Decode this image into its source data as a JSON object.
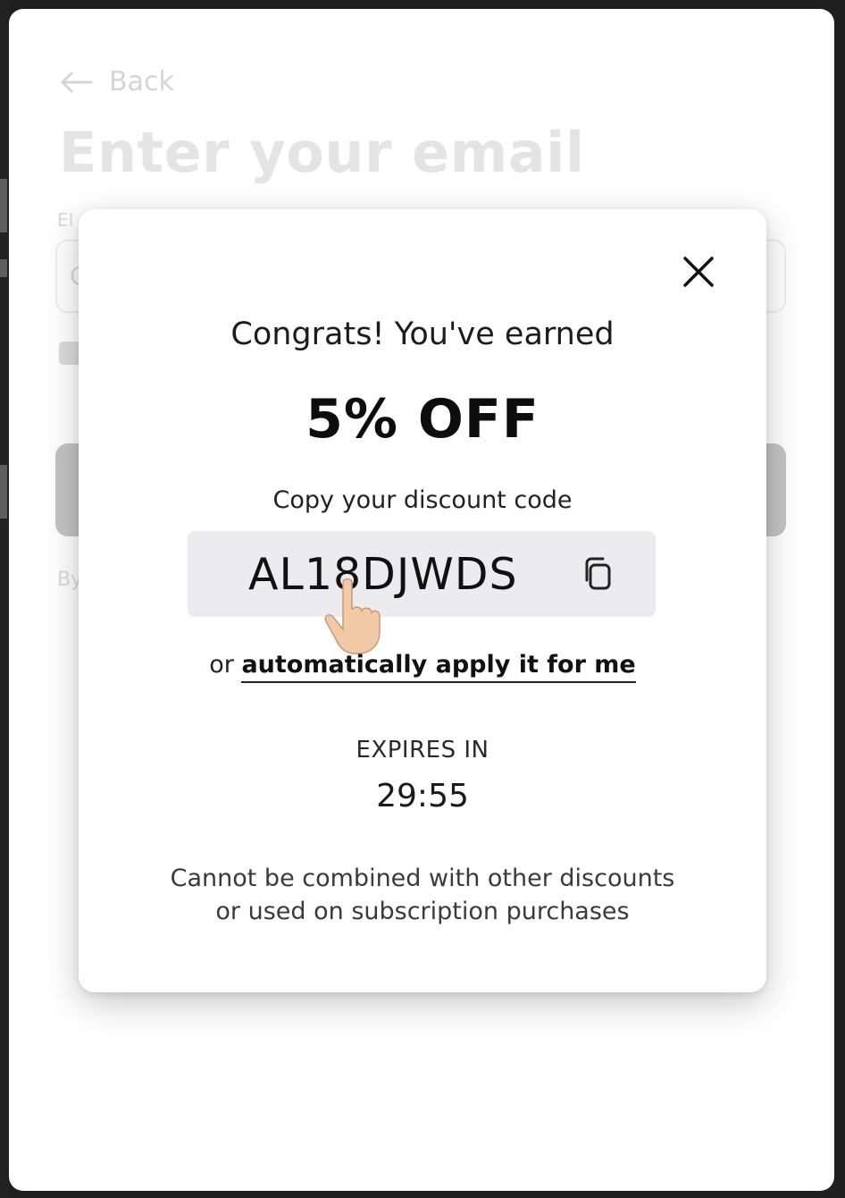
{
  "background_page": {
    "back_label": "Back",
    "title": "Enter your email",
    "field_label": "EI",
    "input_value": "C",
    "legal_text": "By"
  },
  "modal": {
    "congrats_text": "Congrats! You've earned",
    "offer": "5% OFF",
    "copy_label": "Copy your discount code",
    "discount_code": "AL18DJWDS",
    "apply_prefix": "or",
    "apply_link": "automatically apply it for me",
    "expires_label": "EXPIRES IN",
    "timer": "29:55",
    "disclaimer_line1": "Cannot be combined with other discounts",
    "disclaimer_line2": "or used on subscription purchases"
  },
  "icons": {
    "back": "arrow-left-icon",
    "close": "close-icon",
    "copy": "copy-icon",
    "cursor": "hand-pointer-icon"
  },
  "colors": {
    "modal_background": "#ffffff",
    "code_box_background": "#ececee",
    "text_primary": "#111111",
    "overlay_text": "#b5b5b5"
  }
}
